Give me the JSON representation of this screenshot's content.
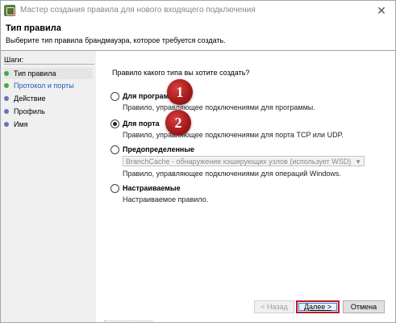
{
  "window": {
    "title": "Мастер создания правила для нового входящего подключения",
    "close_glyph": "✕"
  },
  "header": {
    "title": "Тип правила",
    "subtitle": "Выберите тип правила брандмауэра, которое требуется создать."
  },
  "sidebar": {
    "steps_label": "Шаги:",
    "steps": [
      {
        "label": "Тип правила",
        "state": "current"
      },
      {
        "label": "Протокол и порты",
        "state": "link"
      },
      {
        "label": "Действие",
        "state": "pending"
      },
      {
        "label": "Профиль",
        "state": "pending"
      },
      {
        "label": "Имя",
        "state": "pending"
      }
    ]
  },
  "main": {
    "question": "Правило какого типа вы хотите создать?",
    "options": [
      {
        "label": "Для программы",
        "description": "Правило, управляющее подключениями для программы.",
        "checked": false
      },
      {
        "label": "Для порта",
        "description": "Правило, управляющее подключениями для порта TCP или UDP.",
        "checked": true
      },
      {
        "label": "Предопределенные",
        "combo_value": "BranchCache - обнаружение кэширующих узлов (использует WSD)",
        "description": "Правило, управляющее подключениями для операций Windows.",
        "checked": false
      },
      {
        "label": "Настраиваемые",
        "description": "Настраиваемое правило.",
        "checked": false
      }
    ]
  },
  "badges": [
    "1",
    "2"
  ],
  "buttons": {
    "back": "< Назад",
    "next": "Далее >",
    "cancel": "Отмена"
  },
  "colors": {
    "step_done": "#3fae3a",
    "step_pending": "#6f6fb8",
    "link": "#1c5fb6",
    "badge": "#a01818",
    "next_highlight": "#c0182a"
  }
}
